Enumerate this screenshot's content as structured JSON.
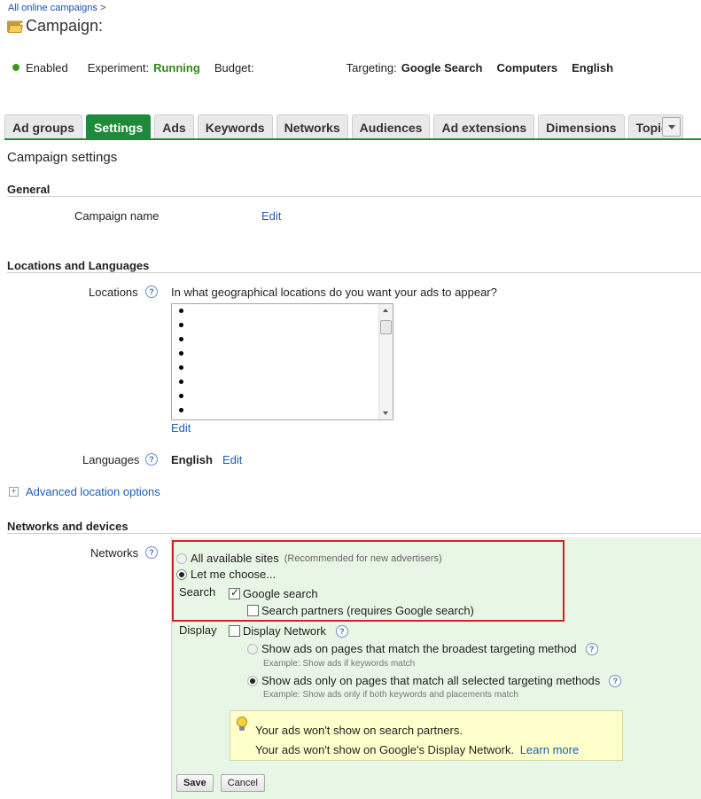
{
  "breadcrumb": {
    "link": "All online campaigns",
    "sep": ">"
  },
  "title": "Campaign:",
  "status": {
    "enabled": "Enabled",
    "experiment_label": "Experiment:",
    "experiment_value": "Running",
    "budget_label": "Budget:",
    "targeting_label": "Targeting:",
    "targeting_values": [
      "Google Search",
      "Computers",
      "English"
    ]
  },
  "tabs": [
    "Ad groups",
    "Settings",
    "Ads",
    "Keywords",
    "Networks",
    "Audiences",
    "Ad extensions",
    "Dimensions",
    "Topics"
  ],
  "active_tab": "Settings",
  "page_title": "Campaign settings",
  "general": {
    "heading": "General",
    "campaign_name_label": "Campaign name",
    "edit": "Edit"
  },
  "locations_languages": {
    "heading": "Locations and Languages",
    "locations_label": "Locations",
    "locations_question": "In what geographical locations do you want your ads to appear?",
    "locations_edit": "Edit",
    "languages_label": "Languages",
    "languages_value": "English",
    "languages_edit": "Edit",
    "advanced": "Advanced location options"
  },
  "networks_devices": {
    "heading": "Networks and devices",
    "networks_label": "Networks",
    "all_sites": "All available sites",
    "all_sites_note": "(Recommended for new advertisers)",
    "let_me_choose": "Let me choose...",
    "search_label": "Search",
    "google_search": "Google search",
    "search_partners": "Search partners (requires Google search)",
    "display_label": "Display",
    "display_network": "Display Network",
    "broad_option": "Show ads on pages that match the broadest targeting method",
    "broad_example": "Example: Show ads if keywords match",
    "all_option": "Show ads only on pages that match all selected targeting methods",
    "all_example": "Example: Show ads only if both keywords and placements match",
    "info_line1": "Your ads won't show on search partners.",
    "info_line2": "Your ads won't show on Google's Display Network.",
    "learn_more": "Learn more",
    "save": "Save",
    "cancel": "Cancel"
  },
  "help_glyph": "?",
  "colors": {
    "accent": "#1f8a3b",
    "link": "#1c5db6",
    "highlight_box": "#d6202a",
    "panel": "#e8f6e5"
  }
}
